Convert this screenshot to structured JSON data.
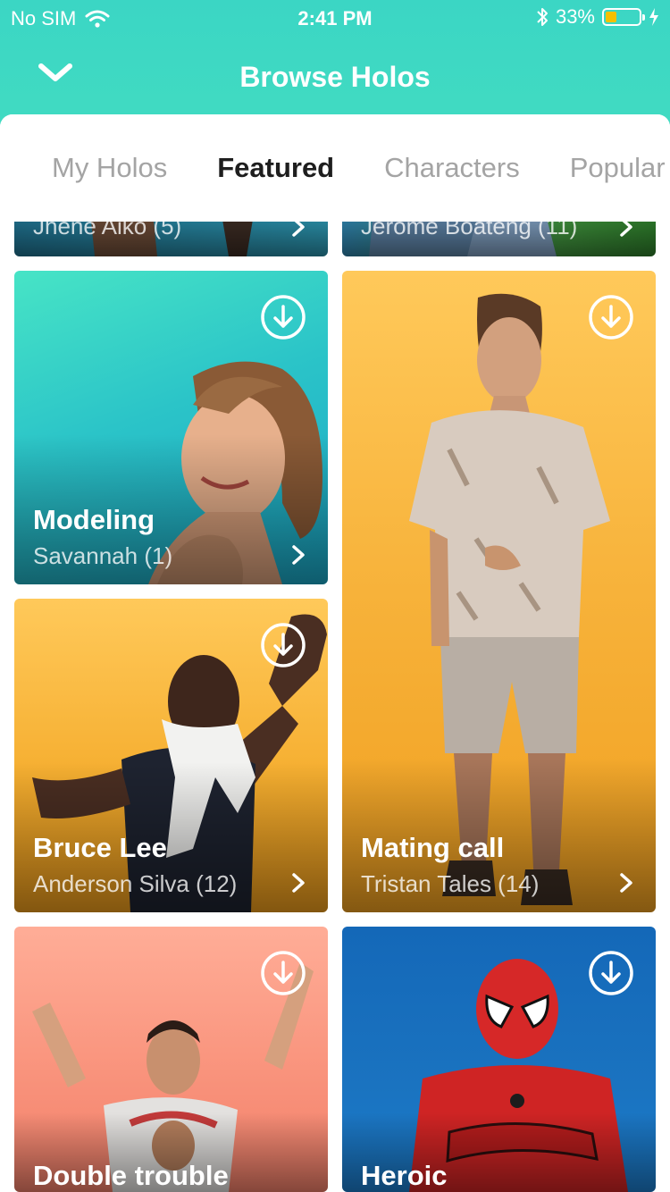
{
  "status_bar": {
    "carrier": "No SIM",
    "time": "2:41 PM",
    "battery_percent": "33%",
    "battery_level": 0.33
  },
  "nav": {
    "title": "Browse Holos"
  },
  "tabs": [
    {
      "label": "My Holos",
      "active": false
    },
    {
      "label": "Featured",
      "active": true
    },
    {
      "label": "Characters",
      "active": false
    },
    {
      "label": "Popular",
      "active": false
    }
  ],
  "cards": [
    {
      "title": "",
      "subtitle": "Jhene Aiko (5)",
      "bg": "#1f7f9c"
    },
    {
      "title": "",
      "subtitle": "Jerome Boateng (11)",
      "bg": "#3f8f2a"
    },
    {
      "title": "Modeling",
      "subtitle": "Savannah (1)",
      "bg": "teal"
    },
    {
      "title": "Mating call",
      "subtitle": "Tristan Tales (14)",
      "bg": "amber"
    },
    {
      "title": "Bruce Lee",
      "subtitle": "Anderson Silva (12)",
      "bg": "amber"
    },
    {
      "title": "Double trouble",
      "subtitle": "",
      "bg": "salmon"
    },
    {
      "title": "Heroic",
      "subtitle": "",
      "bg": "blue"
    }
  ],
  "colors": {
    "header_top": "#3bd6c4",
    "header_bottom": "#46dfc0",
    "teal_card": "#2cc8c5",
    "amber_card": "#f4ac2c",
    "salmon_card": "#f9917c",
    "blue_card": "#1565b8",
    "battery": "#f5c000"
  },
  "icons": {
    "nav_back": "chevron-down-icon",
    "download": "download-icon",
    "card_chevron": "chevron-right-icon",
    "wifi": "wifi-icon",
    "bluetooth": "bluetooth-icon",
    "charging": "bolt-icon"
  }
}
